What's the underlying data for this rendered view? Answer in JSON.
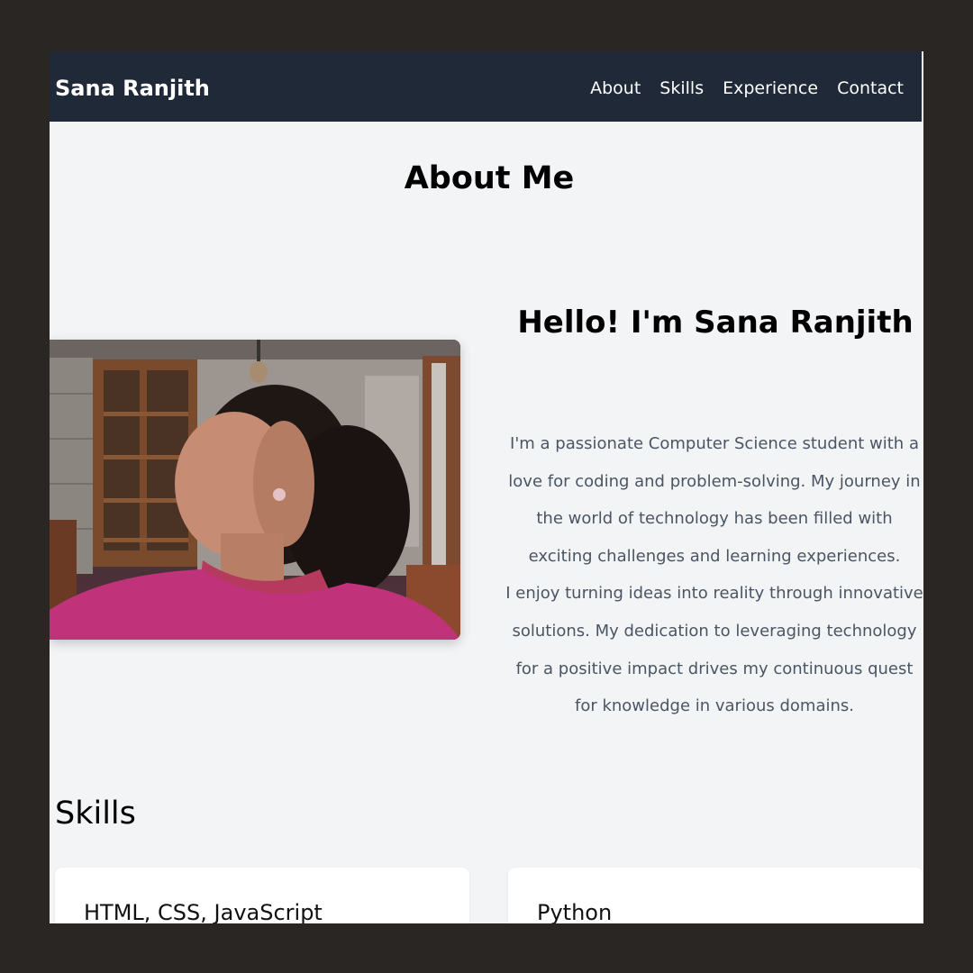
{
  "header": {
    "brand": "Sana Ranjith",
    "nav": [
      "About",
      "Skills",
      "Experience",
      "Contact"
    ]
  },
  "about": {
    "title": "About Me",
    "greeting": "Hello! I'm Sana Ranjith",
    "paragraph_1": "I'm a passionate Computer Science student with a love for coding and problem-solving. My journey in the world of technology has been filled with exciting challenges and learning experiences.",
    "paragraph_2": "I enjoy turning ideas into reality through innovative solutions. My dedication to leveraging technology for a positive impact drives my continuous quest for knowledge in various domains."
  },
  "skills": {
    "title": "Skills",
    "cards": [
      "HTML, CSS, JavaScript",
      "Python"
    ]
  },
  "colors": {
    "navbar": "#1f2937",
    "page_background": "#f2f4f6",
    "outer_frame": "#2a2624",
    "body_text": "#4b5563"
  }
}
